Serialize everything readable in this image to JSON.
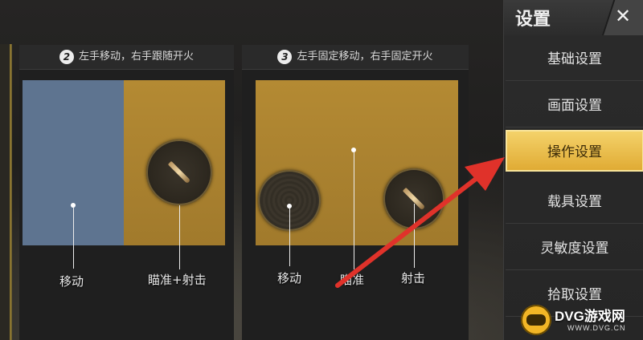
{
  "panels": [
    {
      "number": "2",
      "title": "左手移动，右手跟随开火",
      "labels": {
        "move": "移动",
        "aim_fire": "瞄准+射击"
      }
    },
    {
      "number": "3",
      "title": "左手固定移动，右手固定开火",
      "labels": {
        "move": "移动",
        "aim": "瞄准",
        "fire": "射击"
      }
    }
  ],
  "sidebar": {
    "title": "设置",
    "close_icon": "close-icon",
    "items": [
      {
        "label": "基础设置",
        "active": false
      },
      {
        "label": "画面设置",
        "active": false
      },
      {
        "label": "操作设置",
        "active": true
      },
      {
        "label": "载具设置",
        "active": false
      },
      {
        "label": "灵敏度设置",
        "active": false
      },
      {
        "label": "拾取设置",
        "active": false
      }
    ]
  },
  "watermark": {
    "name": "DVG游戏网",
    "sub": "WWW.DVG.CN"
  },
  "colors": {
    "accent": "#e7b73e",
    "arrow": "#e0322a",
    "move_zone": "#5e7490",
    "fire_zone": "#b08633"
  }
}
